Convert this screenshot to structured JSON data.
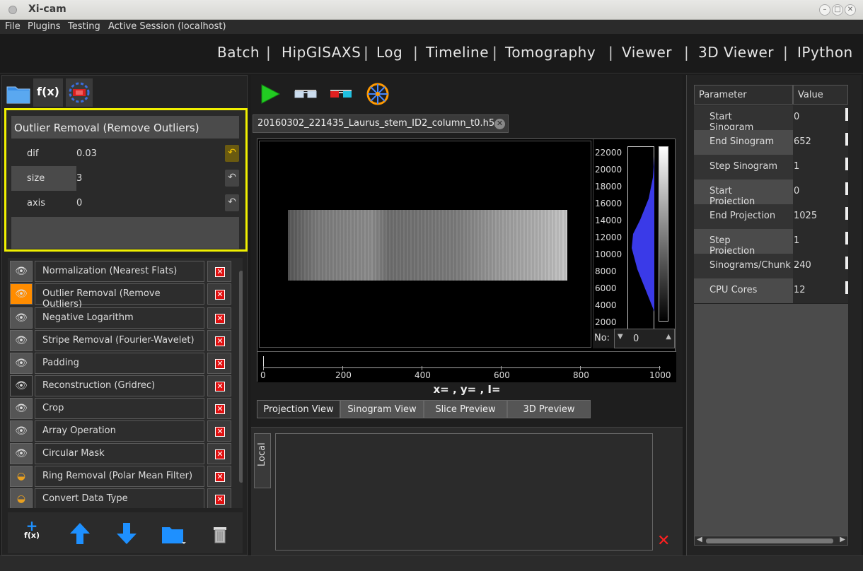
{
  "window": {
    "title": "Xi-cam",
    "min": "–",
    "max": "□",
    "close": "✕"
  },
  "menu": [
    "File",
    "Plugins",
    "Testing",
    "Active Session (localhost)"
  ],
  "nav": [
    "Batch",
    "HipGISAXS",
    "Log",
    "Timeline",
    "Tomography",
    "Viewer",
    "3D Viewer",
    "IPython"
  ],
  "nav_separator": "|",
  "left_tabs": {
    "fx_label": "f(x)"
  },
  "params": {
    "header": "Outlier Removal (Remove Outliers)",
    "rows": [
      {
        "name": "dif",
        "value": "0.03"
      },
      {
        "name": "size",
        "value": "3"
      },
      {
        "name": "axis",
        "value": "0"
      }
    ]
  },
  "workflow": [
    {
      "name": "Normalization (Nearest Flats)",
      "icon": "eye-icon",
      "active": false
    },
    {
      "name": "Outlier Removal (Remove Outliers)",
      "icon": "eye-icon",
      "active": true
    },
    {
      "name": "Negative Logarithm",
      "icon": "eye-icon",
      "active": false
    },
    {
      "name": "Stripe Removal (Fourier-Wavelet)",
      "icon": "eye-icon",
      "active": false
    },
    {
      "name": "Padding",
      "icon": "eye-icon",
      "active": false
    },
    {
      "name": "Reconstruction (Gridrec)",
      "icon": "eye-icon",
      "active": false
    },
    {
      "name": "Crop",
      "icon": "eye-icon",
      "active": false
    },
    {
      "name": "Array Operation",
      "icon": "eye-icon",
      "active": false
    },
    {
      "name": "Circular Mask",
      "icon": "eye-icon",
      "active": false
    },
    {
      "name": "Ring Removal (Polar Mean Filter)",
      "icon": "closed-eye-icon",
      "active": false
    },
    {
      "name": "Convert Data Type",
      "icon": "closed-eye-icon",
      "active": false
    }
  ],
  "delete_glyph": "✕",
  "bottom_tools": {
    "add_label": "f(x)"
  },
  "center": {
    "file_tab": "20160302_221435_Laurus_stem_ID2_column_t0.h5",
    "histogram_ticks": [
      "22000",
      "20000",
      "18000",
      "16000",
      "14000",
      "12000",
      "10000",
      "8000",
      "6000",
      "4000",
      "2000"
    ],
    "no_label": "No:",
    "no_value": "0",
    "timeline_ticks": [
      "0",
      "200",
      "400",
      "600",
      "800",
      "1000"
    ],
    "coords": "x= , y= , I=",
    "view_tabs": [
      "Projection View",
      "Sinogram View",
      "Slice Preview",
      "3D Preview"
    ],
    "local_tab": "Local"
  },
  "right": {
    "headers": [
      "Parameter",
      "Value"
    ],
    "rows": [
      {
        "name": "Start Sinogram",
        "value": "0"
      },
      {
        "name": "End Sinogram",
        "value": "652"
      },
      {
        "name": "Step Sinogram",
        "value": "1"
      },
      {
        "name": "Start Projection",
        "value": "0"
      },
      {
        "name": "End Projection",
        "value": "1025"
      },
      {
        "name": "Step Projection",
        "value": "1"
      },
      {
        "name": "Sinograms/Chunk",
        "value": "240"
      },
      {
        "name": "CPU Cores",
        "value": "12"
      }
    ]
  },
  "colors": {
    "highlight": "#f0f000",
    "active_eye": "#ff8c00",
    "delete": "#e01010",
    "play": "#22cc22",
    "accent_blue": "#1e90ff"
  }
}
